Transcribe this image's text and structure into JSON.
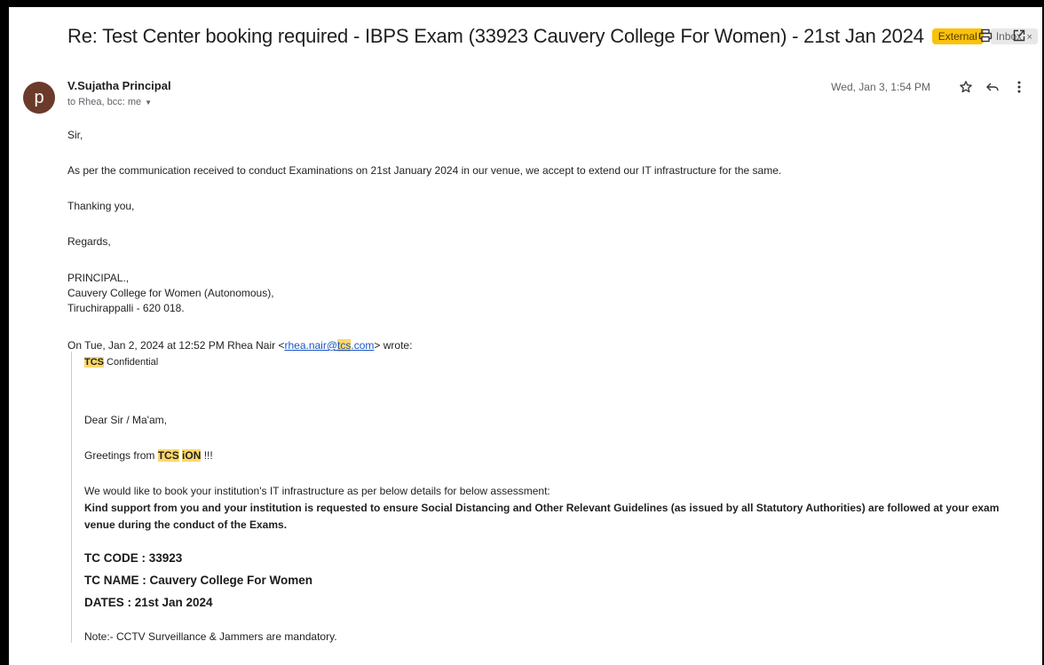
{
  "email": {
    "subject": "Re: Test Center booking required - IBPS Exam (33923 Cauvery College For Women) - 21st Jan 2024",
    "labels": {
      "external": "External",
      "inbox": "Inbox",
      "inbox_remove": "×"
    },
    "top_icons": [
      "print-icon",
      "open-new-window-icon"
    ],
    "sender": {
      "avatar_letter": "p",
      "avatar_color": "#6b3a2a",
      "name": "V.Sujatha Principal",
      "recipients": "to Rhea, bcc: me",
      "date": "Wed, Jan 3, 1:54 PM"
    },
    "message_icons": [
      "star-icon",
      "reply-icon",
      "more-options-icon"
    ],
    "body": {
      "greeting": "Sir,",
      "para1": "As per the communication received  to conduct Examinations on 21st January 2024 in our venue, we accept to extend our IT infrastructure for the same.",
      "thanks": "Thanking you,",
      "regards": "Regards,",
      "sig1": "PRINCIPAL.,",
      "sig2": "Cauvery College for Women (Autonomous),",
      "sig3": "Tiruchirappalli - 620 018."
    },
    "quoted": {
      "header_prefix": "On Tue, Jan 2, 2024 at 12:52 PM Rhea Nair <",
      "email_user": "rhea.nair@",
      "email_domain": "tcs",
      "email_tld": ".com",
      "header_suffix": "> wrote:",
      "conf_tag": "TCS",
      "conf_text": " Confidential",
      "dear": "Dear Sir / Ma'am,",
      "greet_prefix": "Greetings from ",
      "greet_tcs": "TCS",
      "greet_ion": "iON",
      "greet_suffix": " !!!",
      "intro": "We would like to book your institution's IT infrastructure as per below details for below assessment:",
      "support": "Kind support from you and your institution is requested to ensure Social Distancing and Other Relevant Guidelines (as issued by all Statutory Authorities) are followed at your exam venue during the conduct of the Exams.",
      "tc_code": "TC CODE : 33923",
      "tc_name": "TC NAME : Cauvery College For Women",
      "dates": "DATES : 21st Jan 2024",
      "note": "Note:- CCTV Surveillance & Jammers are mandatory."
    },
    "colors": {
      "external_badge": "#f9c20a",
      "highlight": "#fcd86b",
      "link": "#1a56c6"
    }
  }
}
